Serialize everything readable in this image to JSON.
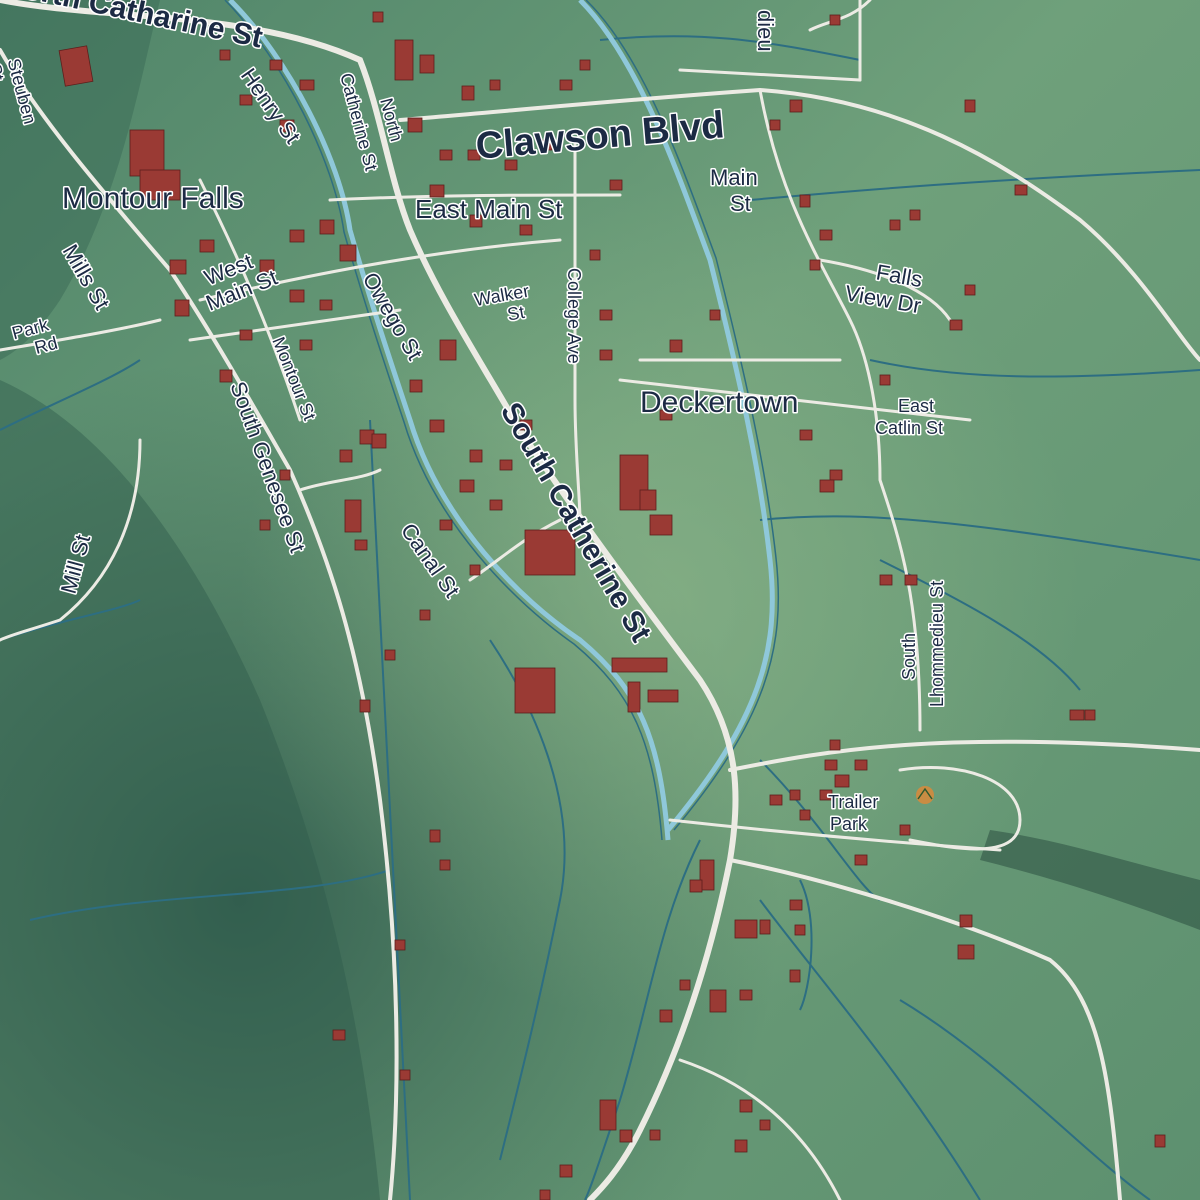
{
  "map": {
    "colors": {
      "terrain": "#6b9b78",
      "terrain_dark": "#2f5a4c",
      "road": "#ecebe4",
      "stream": "#2d6e82",
      "creek": "#8fc8da",
      "building": "#9a3a34",
      "label": "#1c2a44"
    },
    "places": {
      "montour_falls": "Montour Falls",
      "deckertown": "Deckertown",
      "trailer_park": [
        "Trailer",
        "Park"
      ]
    },
    "roads": {
      "north_catharine": "North Catharine St",
      "clawson": "Clawson Blvd",
      "east_main": "East Main St",
      "henry": "Henry St",
      "catherine": "Catherine St",
      "north": "North",
      "steuben": [
        "Steuben",
        "St"
      ],
      "west_main": [
        "West",
        "Main St"
      ],
      "park_rd": [
        "Park",
        "Rd"
      ],
      "mills": "Mills St",
      "mill": "Mill St",
      "walker": [
        "Walker",
        "St"
      ],
      "college": "College Ave",
      "owego": "Owego St",
      "montour": "Montour St",
      "south_catherine": "South Catherine St",
      "south_genesee": "South Genesee St",
      "canal": "Canal St",
      "main_st": [
        "Main",
        "St"
      ],
      "falls_view": [
        "Falls",
        "View Dr"
      ],
      "east_catlin": [
        "East",
        "Catlin St"
      ],
      "south_lhommedieu": [
        "South",
        "Lhommedieu St"
      ],
      "lieu": "dieu"
    }
  }
}
